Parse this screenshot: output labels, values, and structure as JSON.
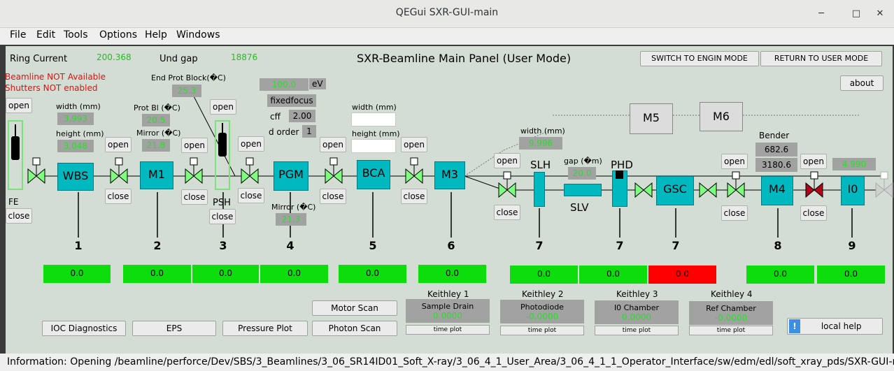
{
  "window": {
    "title": "QEGui SXR-GUI-main"
  },
  "menu": [
    "File",
    "Edit",
    "Tools",
    "Options",
    "Help",
    "Windows"
  ],
  "header": {
    "ring_current_label": "Ring Current",
    "ring_current_value": "200.368",
    "und_gap_label": "Und gap",
    "und_gap_value": "18876",
    "panel_title": "SXR-Beamline Main Panel (User Mode)",
    "switch_engin": "SWITCH TO ENGIN MODE",
    "return_user": "RETURN TO USER MODE",
    "about": "about"
  },
  "warnings": {
    "beamline": "Beamline NOT Available",
    "shutters": "Shutters NOT enabled"
  },
  "labels": {
    "width_mm": "width (mm)",
    "height_mm": "height (mm)",
    "prot_bl": "Prot Bl (�C)",
    "mirror_c": "Mirror (�C)",
    "end_prot": "End Prot Block(�C)",
    "gap_um": "gap (�m)",
    "bender": "Bender",
    "ev": "eV",
    "fixedfocus": "fixedfocus",
    "cff": "cff",
    "d_order": "d order",
    "fe": "FE",
    "psh": "PSH",
    "slh": "SLH",
    "slv": "SLV",
    "phd": "PHD"
  },
  "values": {
    "wbs_width": "3.993",
    "wbs_height": "3.048",
    "prot_bl": "20.5",
    "mirror_m1": "21.8",
    "end_prot": "25.3",
    "energy": "100.0",
    "cff": "2.00",
    "d_order": "1",
    "pgm_mirror": "21.3",
    "slh_width": "9.996",
    "slv_gap": "20.0",
    "bender1": "682.6",
    "bender2": "3180.6",
    "i0_val": "4.990"
  },
  "elements": [
    "WBS",
    "M1",
    "PGM",
    "BCA",
    "M3",
    "GSC",
    "M4",
    "I0",
    "M5",
    "M6"
  ],
  "buttons": {
    "open": "open",
    "close": "close"
  },
  "sections": [
    "1",
    "2",
    "3",
    "4",
    "5",
    "6",
    "7",
    "7",
    "7",
    "8",
    "9"
  ],
  "bars": [
    "0.0",
    "0.0",
    "0.0",
    "0.0",
    "0.0",
    "0.0",
    "0.0",
    "0.0",
    "0.0",
    "0.0",
    "0.0"
  ],
  "bottom_buttons": {
    "ioc": "IOC Diagnostics",
    "eps": "EPS",
    "pressure": "Pressure Plot",
    "motor_scan": "Motor Scan",
    "photon_scan": "Photon Scan",
    "local_help": "local help"
  },
  "keithley": [
    {
      "title": "Keithley 1",
      "name": "Sample Drain",
      "value": "0.0000",
      "plot": "time plot"
    },
    {
      "title": "Keithley 2",
      "name": "Photodiode",
      "value": "-0.0000",
      "plot": "time plot"
    },
    {
      "title": "Keithley 3",
      "name": "I0 Chamber",
      "value": "0.0000",
      "plot": "time plot"
    },
    {
      "title": "Keithley 4",
      "name": "Ref Chamber",
      "value": "-0.0000",
      "plot": "time plot"
    }
  ],
  "status": "Information: Opening /beamline/perforce/Dev/SBS/3_Beamlines/3_06_SR14ID01_Soft_X-ray/3_06_4_1_User_Area/3_06_4_1_1_Operator_Interface/sw/edm/edl/soft_xray_pds/SXR-GUI-ma",
  "colors": {
    "panel": "#d4ddd4",
    "element": "#00b8c0",
    "bar_ok": "#0ddd0d",
    "bar_alarm": "#ff0000",
    "valve_open": "#7fff7f",
    "valve_closed": "#b0001a",
    "readback": "#2cdc2c"
  }
}
